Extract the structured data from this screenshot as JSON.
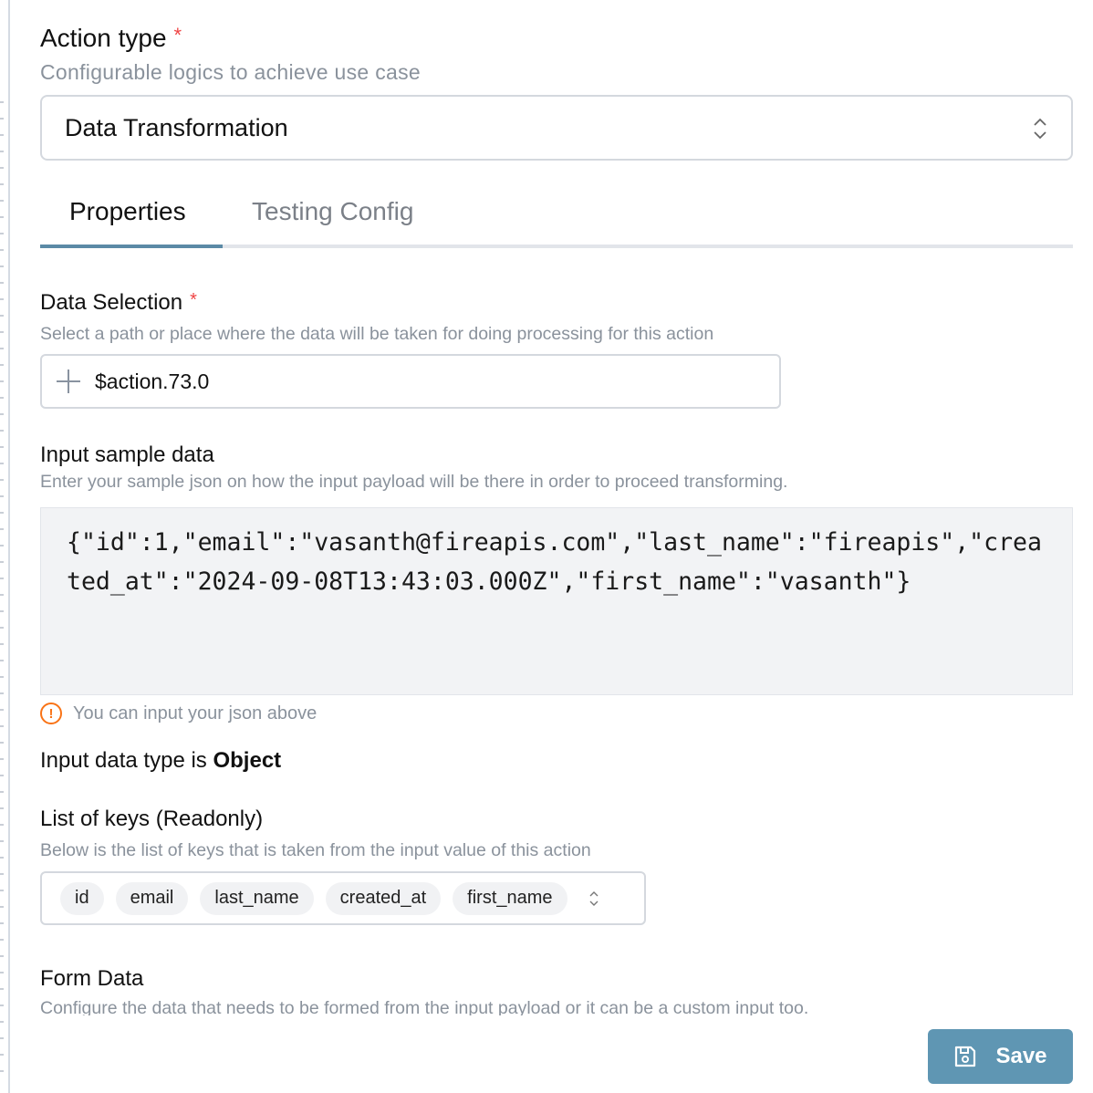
{
  "action_type": {
    "label": "Action type",
    "required": "*",
    "description": "Configurable logics to achieve use case",
    "value": "Data Transformation"
  },
  "tabs": [
    {
      "label": "Properties",
      "active": true
    },
    {
      "label": "Testing Config",
      "active": false
    }
  ],
  "data_selection": {
    "label": "Data Selection",
    "required": "*",
    "description": "Select a path or place where the data will be taken for doing processing for this action",
    "value": "$action.73.0"
  },
  "input_sample": {
    "label": "Input sample data",
    "description": "Enter your sample json on how the input payload will be there in order to proceed transforming.",
    "value": "{\"id\":1,\"email\":\"vasanth@fireapis.com\",\"last_name\":\"fireapis\",\"created_at\":\"2024-09-08T13:43:03.000Z\",\"first_name\":\"vasanth\"}",
    "hint": "You can input your json above"
  },
  "data_type": {
    "prefix": "Input data type is ",
    "value": "Object"
  },
  "keys": {
    "label": "List of keys (Readonly)",
    "description": "Below is the list of keys that is taken from the input value of this action",
    "items": [
      "id",
      "email",
      "last_name",
      "created_at",
      "first_name"
    ]
  },
  "form_data": {
    "label": "Form Data",
    "description": "Configure the data that needs to be formed from the input payload or it can be a custom input too."
  },
  "save": {
    "label": "Save",
    "icon": "save-icon"
  },
  "colors": {
    "accent": "#5b8aa6",
    "button": "#5f96b3",
    "required": "#ef4444",
    "warning": "#f97316"
  }
}
